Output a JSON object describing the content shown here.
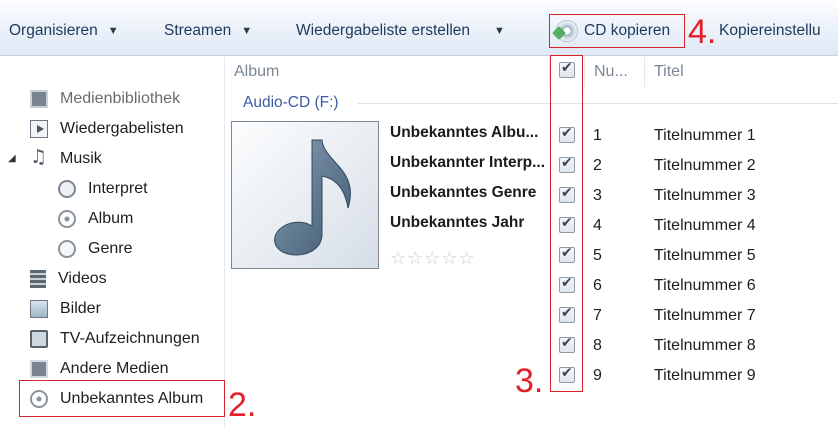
{
  "toolbar": {
    "organize": "Organisieren",
    "stream": "Streamen",
    "create_playlist": "Wiedergabeliste erstellen",
    "rip_cd": "CD kopieren",
    "rip_settings": "Kopiereinstellu",
    "dropdown_arrow": "▼"
  },
  "sidebar": {
    "items": [
      {
        "label": "Medienbibliothek",
        "icon": "library-icon"
      },
      {
        "label": "Wiedergabelisten",
        "icon": "playlist-icon"
      },
      {
        "label": "Musik",
        "icon": "music-icon"
      },
      {
        "label": "Interpret",
        "icon": "artist-icon"
      },
      {
        "label": "Album",
        "icon": "album-icon"
      },
      {
        "label": "Genre",
        "icon": "genre-icon"
      },
      {
        "label": "Videos",
        "icon": "video-icon"
      },
      {
        "label": "Bilder",
        "icon": "pictures-icon"
      },
      {
        "label": "TV-Aufzeichnungen",
        "icon": "tv-icon"
      },
      {
        "label": "Andere Medien",
        "icon": "other-media-icon"
      },
      {
        "label": "Unbekanntes Album",
        "icon": "cd-icon"
      }
    ]
  },
  "columns": {
    "album": "Album",
    "number": "Nu...",
    "title": "Titel"
  },
  "group": {
    "title": "Audio-CD (F:)"
  },
  "album_info": {
    "album": "Unbekanntes Albu...",
    "artist": "Unbekannter Interp...",
    "genre": "Unbekanntes Genre",
    "year": "Unbekanntes Jahr",
    "rating_stars": "☆☆☆☆☆"
  },
  "tracks": [
    {
      "num": "1",
      "title": "Titelnummer 1",
      "checked": true
    },
    {
      "num": "2",
      "title": "Titelnummer 2",
      "checked": true
    },
    {
      "num": "3",
      "title": "Titelnummer 3",
      "checked": true
    },
    {
      "num": "4",
      "title": "Titelnummer 4",
      "checked": true
    },
    {
      "num": "5",
      "title": "Titelnummer 5",
      "checked": true
    },
    {
      "num": "6",
      "title": "Titelnummer 6",
      "checked": true
    },
    {
      "num": "7",
      "title": "Titelnummer 7",
      "checked": true
    },
    {
      "num": "8",
      "title": "Titelnummer 8",
      "checked": true
    },
    {
      "num": "9",
      "title": "Titelnummer 9",
      "checked": true
    }
  ],
  "annotations": {
    "step2": "2.",
    "step3": "3.",
    "step4": "4.",
    "color": "#e2202a"
  }
}
